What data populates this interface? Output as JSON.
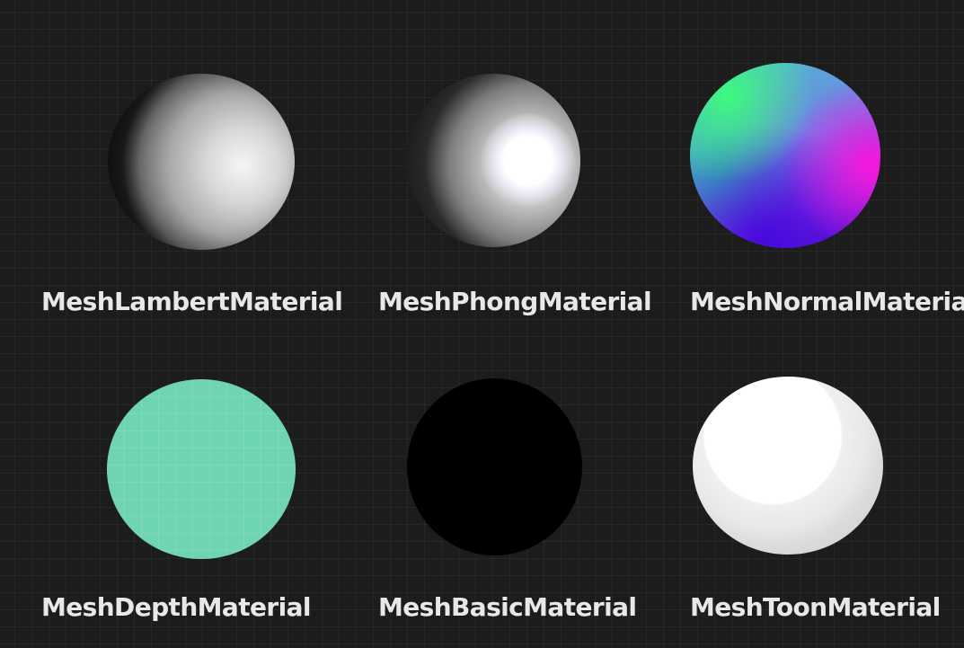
{
  "materials": [
    {
      "label": "MeshLambertMaterial",
      "icon": "lambert-sphere-icon"
    },
    {
      "label": "MeshPhongMaterial",
      "icon": "phong-sphere-icon"
    },
    {
      "label": "MeshNormalMaterial",
      "icon": "normal-sphere-icon"
    },
    {
      "label": "MeshDepthMaterial",
      "icon": "depth-sphere-icon"
    },
    {
      "label": "MeshBasicMaterial",
      "icon": "basic-sphere-icon"
    },
    {
      "label": "MeshToonMaterial",
      "icon": "toon-sphere-icon"
    }
  ],
  "colors": {
    "background": "#1c1c1c",
    "label": "#e8e8e8",
    "depth_sphere": "#6fd4b2",
    "basic_sphere": "#000000"
  }
}
